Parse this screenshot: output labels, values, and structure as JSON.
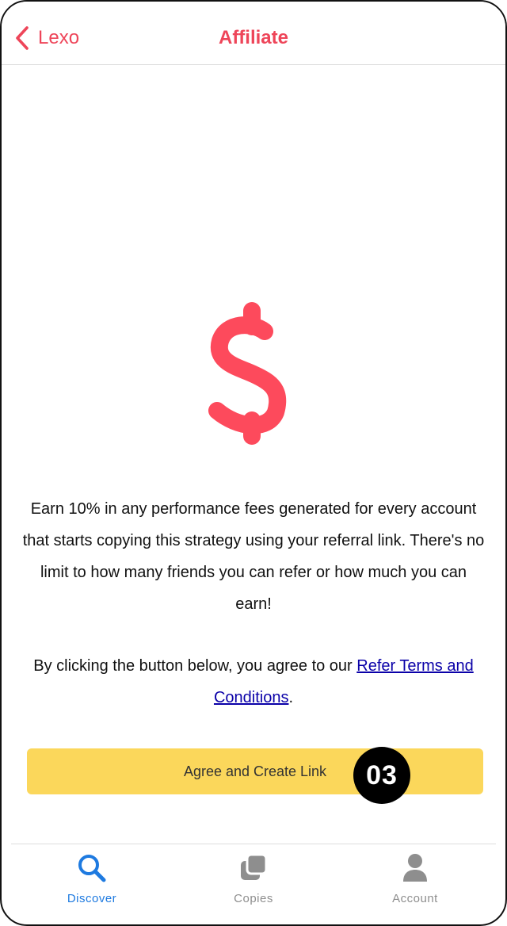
{
  "navbar": {
    "back_label": "Lexo",
    "title": "Affiliate"
  },
  "main": {
    "icon": "dollar-sign-icon",
    "description": "Earn 10% in any performance fees generated for every account that starts copying this strategy using your referral link. There's no limit to how many friends you can refer or how much you can earn!",
    "terms_prefix": "By clicking the button below, you agree to our ",
    "terms_link": "Refer Terms and Conditions",
    "terms_suffix": ".",
    "cta_label": "Agree and Create Link",
    "step_badge": "03"
  },
  "tabbar": {
    "tabs": [
      {
        "label": "Discover",
        "icon": "search-icon",
        "active": true
      },
      {
        "label": "Copies",
        "icon": "copies-icon",
        "active": false
      },
      {
        "label": "Account",
        "icon": "account-icon",
        "active": false
      }
    ]
  },
  "colors": {
    "accent": "#ee4559",
    "cta": "#fbd75b",
    "link": "#0a00a8",
    "tab_active": "#1e7ae0",
    "tab_inactive": "#8e8e8e"
  }
}
